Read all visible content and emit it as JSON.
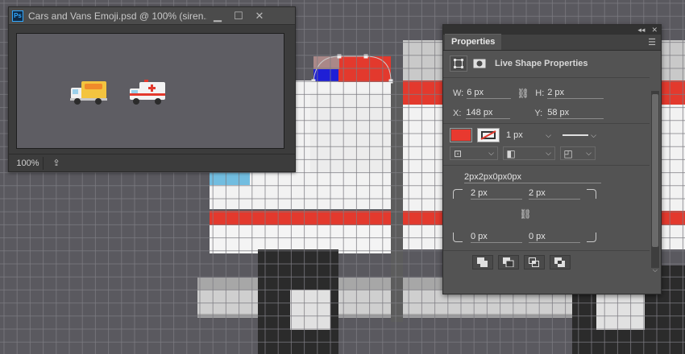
{
  "document_window": {
    "app_logo": "Ps",
    "title": "Cars and Vans Emoji.psd @ 100% (siren...",
    "minimize_icon": "minimize-icon",
    "maximize_icon": "maximize-icon",
    "close_icon": "close-icon",
    "zoom": "100%",
    "share_icon": "share-icon"
  },
  "colors": {
    "canvas_bg": "#5a595f",
    "ui_panel": "#535353",
    "fill_swatch": "#e8392f",
    "grid": "#7d7c82",
    "ambulance_red": "#e3392d",
    "ambulance_white": "#f2f2f2",
    "selection_blue": "#1f1fd6"
  },
  "properties_panel": {
    "collapse_icon": "double-chevron-icon",
    "close_icon": "close-icon",
    "tab": "Properties",
    "menu_icon": "panel-menu-icon",
    "header": "Live Shape Properties",
    "w_label": "W:",
    "w_value": "6 px",
    "h_label": "H:",
    "h_value": "2 px",
    "x_label": "X:",
    "x_value": "148 px",
    "y_label": "Y:",
    "y_value": "58 px",
    "stroke_width": "1 px",
    "corner_radii_summary": "2px2px0px0px",
    "tl_radius": "2 px",
    "tr_radius": "2 px",
    "bl_radius": "0 px",
    "br_radius": "0 px"
  }
}
